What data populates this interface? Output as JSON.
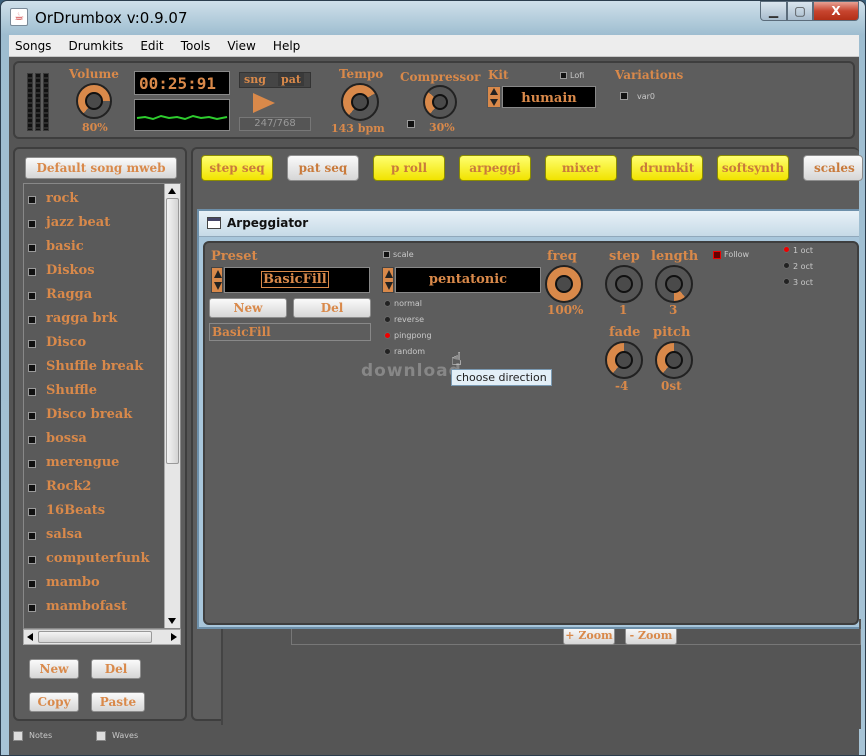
{
  "window": {
    "title": "OrDrumbox v:0.9.07",
    "min_label": "▁",
    "max_label": "▢",
    "close_label": "X"
  },
  "menu": [
    "Songs",
    "Drumkits",
    "Edit",
    "Tools",
    "View",
    "Help"
  ],
  "top": {
    "volume_label": "Volume",
    "volume_value": "80%",
    "time": "00:25:91",
    "sng_label": "sng",
    "pat_label": "pat",
    "position": "247/768",
    "tempo_label": "Tempo",
    "tempo_value": "143 bpm",
    "compressor_label": "Compressor",
    "compressor_value": "30%",
    "kit_label": "Kit",
    "kit_value": "humain",
    "lofi_label": "Lofi",
    "variations_label": "Variations",
    "var_label": "var0"
  },
  "song_button": "Default song mweb",
  "songs": [
    "rock",
    "jazz beat",
    "basic",
    "Diskos",
    "Ragga",
    "ragga brk",
    "Disco",
    "Shuffle break",
    "Shuffle",
    "Disco break",
    "bossa",
    "merengue",
    "Rock2",
    "16Beats",
    "salsa",
    "computerfunk",
    "mambo",
    "mambofast"
  ],
  "left_buttons": {
    "new": "New",
    "del": "Del",
    "copy": "Copy",
    "paste": "Paste"
  },
  "tabs": [
    "step seq",
    "pat seq",
    "p roll",
    "arpeggi",
    "mixer",
    "drumkit",
    "softsynth",
    "scales"
  ],
  "arp": {
    "title": "Arpeggiator",
    "preset_label": "Preset",
    "preset_value": "BasicFill",
    "new": "New",
    "del": "Del",
    "preset_name": "BasicFill",
    "scale_label": "scale",
    "scale_value": "pentatonic",
    "directions": [
      "normal",
      "reverse",
      "pingpong",
      "random"
    ],
    "freq_label": "freq",
    "freq_value": "100%",
    "step_label": "step",
    "step_value": "1",
    "length_label": "length",
    "length_value": "3",
    "fade_label": "fade",
    "fade_value": "-4",
    "pitch_label": "pitch",
    "pitch_value": "0st",
    "follow_label": "Follow",
    "octaves": [
      "1 oct",
      "2 oct",
      "3 oct"
    ],
    "tooltip": "choose direction",
    "watermark": "download"
  },
  "zoom": {
    "plus": "+ Zoom",
    "minus": "- Zoom"
  },
  "bottom": {
    "notes": "Notes",
    "waves": "Waves"
  },
  "colors": {
    "accent": "#d9894a",
    "tab_yellow": "#f1e300",
    "panel": "#5d5d5d"
  }
}
